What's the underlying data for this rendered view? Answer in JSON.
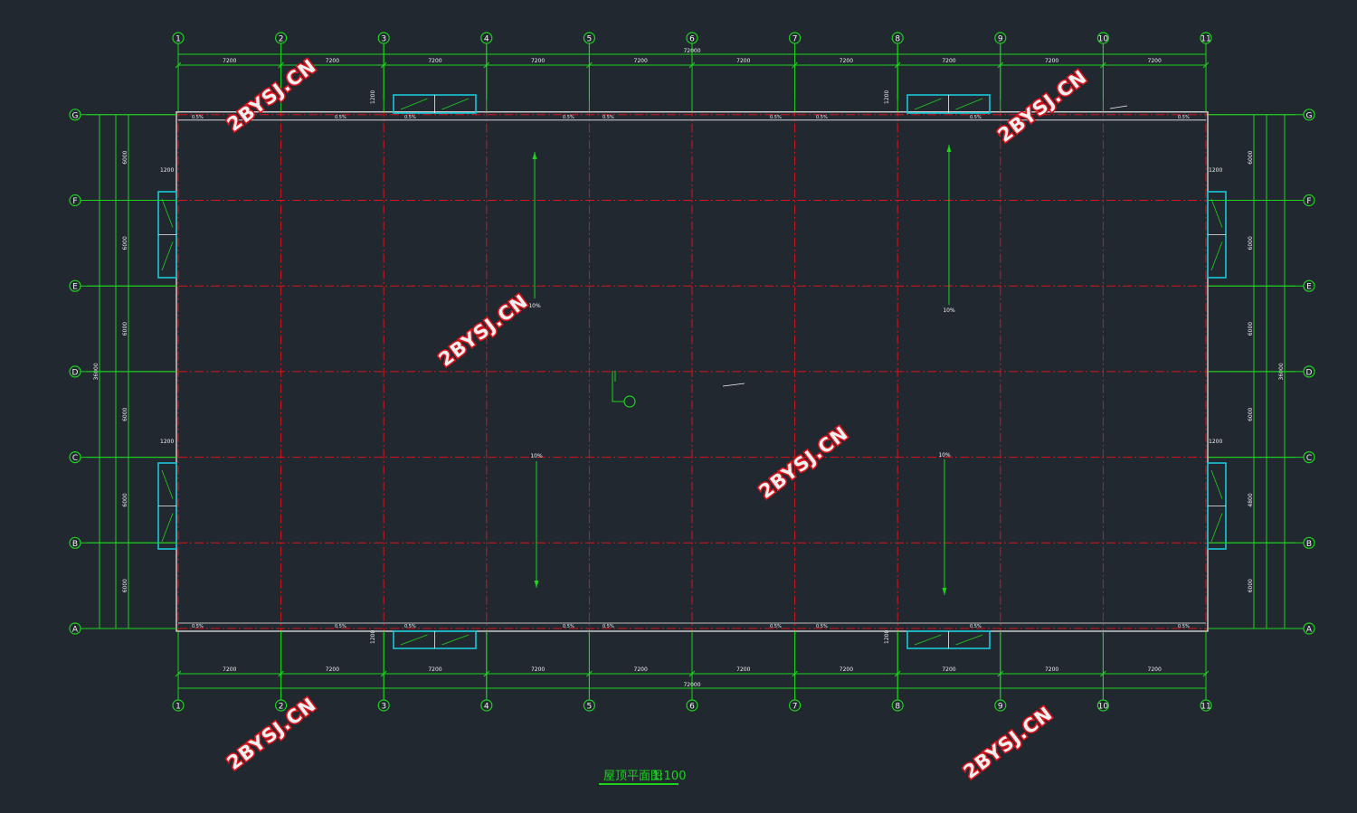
{
  "drawing": {
    "title": "屋顶平面图",
    "scale": "1:100",
    "col_axes": [
      "1",
      "2",
      "3",
      "4",
      "5",
      "6",
      "7",
      "8",
      "9",
      "10",
      "11"
    ],
    "row_axes": [
      "A",
      "B",
      "C",
      "D",
      "E",
      "F",
      "G"
    ],
    "bay_dim": "7200",
    "total_width_dim": "72000",
    "total_depth_dim": "36000",
    "row_bay_dims_left": [
      "6000",
      "6000",
      "6000",
      "6000",
      "6000",
      "6000"
    ],
    "row_bay_dims_right": [
      "6000",
      "4800",
      "6000",
      "6000",
      "6000",
      "6000"
    ],
    "opening_dim": "1200",
    "slope_label": "10%",
    "gutter_slope_label": "0.5%",
    "watermark": "2BYSJ.CN",
    "colors": {
      "background": "#212830",
      "axis_green": "#1ed21e",
      "grid_red": "#d8141c",
      "outline_white": "#f2f2f2",
      "window_cyan": "#18c8d8"
    }
  }
}
